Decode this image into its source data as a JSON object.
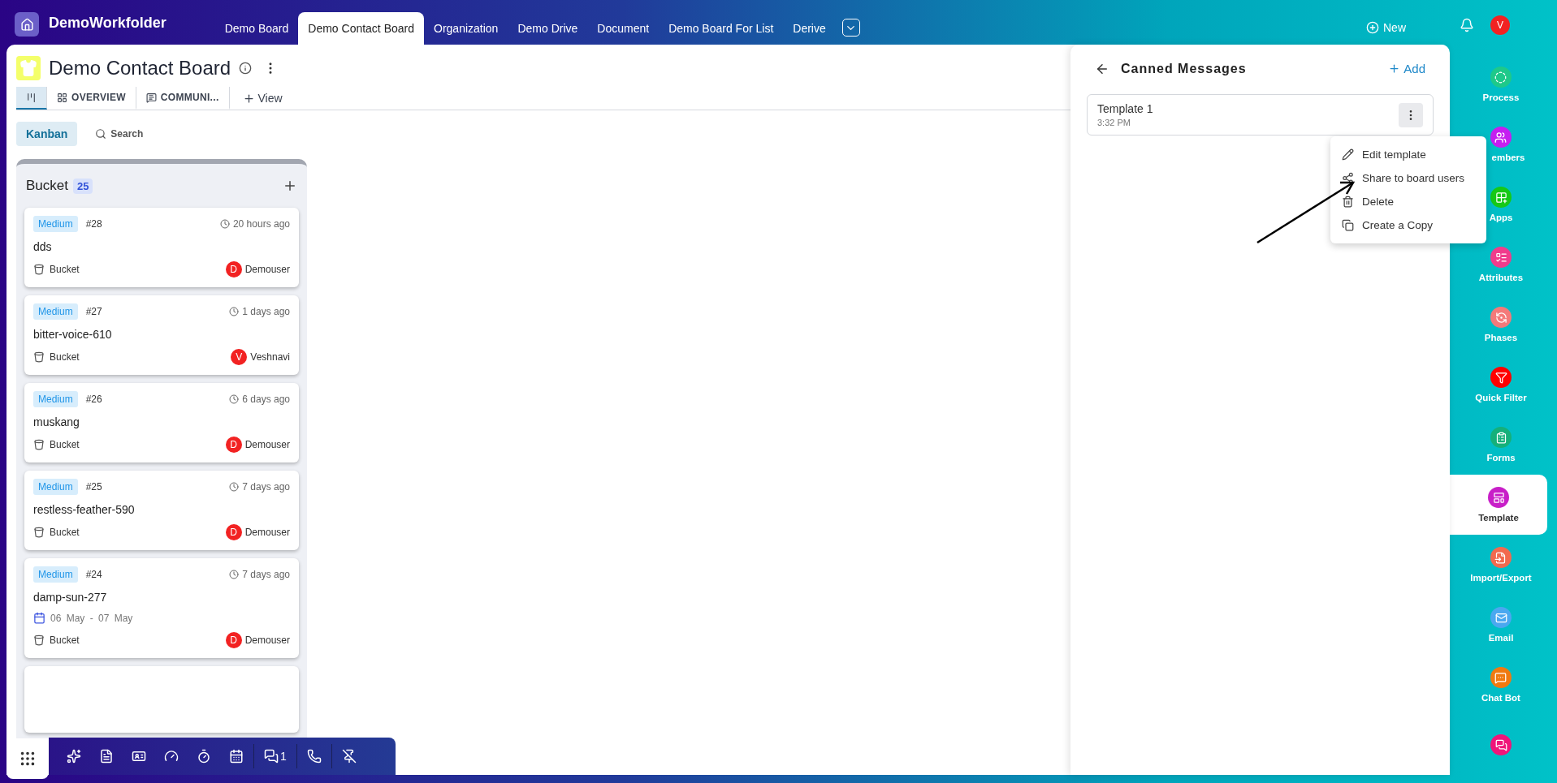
{
  "top_bar": {
    "workspace": "DemoWorkfolder",
    "tabs": [
      {
        "label": "Demo Board",
        "selected": false
      },
      {
        "label": "Demo Contact Board",
        "selected": true
      },
      {
        "label": "Organization",
        "selected": false
      },
      {
        "label": "Demo Drive",
        "selected": false
      },
      {
        "label": "Document",
        "selected": false
      },
      {
        "label": "Demo Board For List",
        "selected": false
      },
      {
        "label": "Derive",
        "selected": false
      }
    ],
    "new_button": "New",
    "avatar": "V"
  },
  "board": {
    "title": "Demo Contact Board",
    "view_tabs": [
      {
        "kind": "kanban",
        "selected": true
      },
      {
        "kind": "overview",
        "label": "OVERVIEW",
        "selected": false
      },
      {
        "kind": "communication",
        "label": "COMMUNI...",
        "selected": false
      }
    ],
    "add_view": "View",
    "mode": "Kanban",
    "search": "Search",
    "column": {
      "title": "Bucket",
      "count": "25",
      "cards": [
        {
          "priority": "Medium",
          "number": "#28",
          "time": "20 hours ago",
          "title": "dds",
          "bucket": "Bucket",
          "avatar": "D",
          "user": "Demouser"
        },
        {
          "priority": "Medium",
          "number": "#27",
          "time": "1 days ago",
          "title": "bitter-voice-610",
          "bucket": "Bucket",
          "avatar": "V",
          "user": "Veshnavi"
        },
        {
          "priority": "Medium",
          "number": "#26",
          "time": "6 days ago",
          "title": "muskang",
          "bucket": "Bucket",
          "avatar": "D",
          "user": "Demouser"
        },
        {
          "priority": "Medium",
          "number": "#25",
          "time": "7 days ago",
          "title": "restless-feather-590",
          "bucket": "Bucket",
          "avatar": "D",
          "user": "Demouser"
        },
        {
          "priority": "Medium",
          "number": "#24",
          "time": "7 days ago",
          "title": "damp-sun-277",
          "dates": "06 May - 07 May",
          "bucket": "Bucket",
          "avatar": "D",
          "user": "Demouser"
        }
      ]
    }
  },
  "canned_messages": {
    "title": "Canned Messages",
    "add": "Add",
    "templates": [
      {
        "name": "Template 1",
        "time": "3:32 PM"
      }
    ],
    "menu": [
      {
        "kind": "edit",
        "label": "Edit template"
      },
      {
        "kind": "share",
        "label": "Share to board users"
      },
      {
        "kind": "delete",
        "label": "Delete"
      },
      {
        "kind": "copy",
        "label": "Create a Copy"
      }
    ]
  },
  "sidebar": [
    {
      "kind": "process",
      "label": "Process",
      "color": "#1ec98a",
      "selected": false
    },
    {
      "kind": "members",
      "label": "embers",
      "color": "#c51ff0",
      "selected": false
    },
    {
      "kind": "apps",
      "label": "Apps",
      "color": "#16c916",
      "selected": false
    },
    {
      "kind": "attributes",
      "label": "Attributes",
      "color": "#f03c8c",
      "selected": false
    },
    {
      "kind": "phases",
      "label": "Phases",
      "color": "#f47a7a",
      "selected": false
    },
    {
      "kind": "filter",
      "label": "Quick Filter",
      "color": "#ff0000",
      "selected": false
    },
    {
      "kind": "forms",
      "label": "Forms",
      "color": "#15b07a",
      "selected": false
    },
    {
      "kind": "template",
      "label": "Template",
      "color": "#c81fc8",
      "selected": true
    },
    {
      "kind": "import",
      "label": "Import/Export",
      "color": "#f26a4f",
      "selected": false
    },
    {
      "kind": "email",
      "label": "Email",
      "color": "#4aa8f0",
      "selected": false
    },
    {
      "kind": "chatbot",
      "label": "Chat Bot",
      "color": "#f07a10",
      "selected": false
    },
    {
      "kind": "messages",
      "color": "#f0157a",
      "selected": false
    }
  ],
  "bottom_toolbar": {
    "chat_count": "1"
  }
}
